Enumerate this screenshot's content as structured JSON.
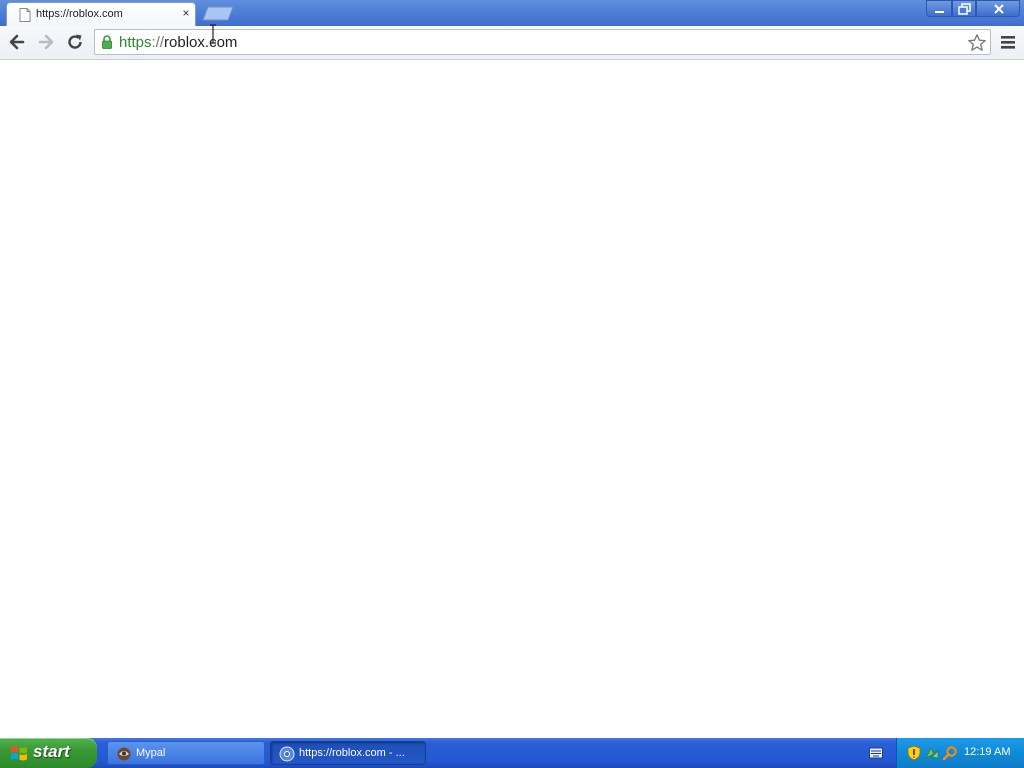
{
  "browser": {
    "tab": {
      "title": "https://roblox.com",
      "close_glyph": "×",
      "favicon": "page-icon"
    },
    "window_controls": {
      "minimize": "minimize-icon",
      "maximize": "restore-icon",
      "close": "close-icon"
    },
    "toolbar": {
      "back_icon": "arrow-left-icon",
      "forward_icon": "arrow-right-icon",
      "reload_icon": "reload-icon",
      "address": {
        "scheme": "https",
        "separator": "://",
        "host": "roblox.com",
        "secure_icon": "lock-icon"
      },
      "bookmark_icon": "star-icon",
      "menu_icon": "hamburger-menu-icon"
    }
  },
  "taskbar": {
    "start_label": "start",
    "items": [
      {
        "label": "Mypal",
        "icon": "mypal-icon",
        "active": false
      },
      {
        "label": "https://roblox.com - ...",
        "icon": "chrome-icon",
        "active": true
      }
    ],
    "tray": {
      "icons": [
        "keyboard-icon",
        "security-shield-icon",
        "network-icon",
        "search-icon"
      ],
      "clock": "12:19 AM"
    }
  },
  "colors": {
    "titlebar": "#4a7ad4",
    "secure_green": "#2a8a2a",
    "taskbar_blue": "#2457d0",
    "start_green": "#3a9a36",
    "tray_blue": "#118ad8"
  }
}
